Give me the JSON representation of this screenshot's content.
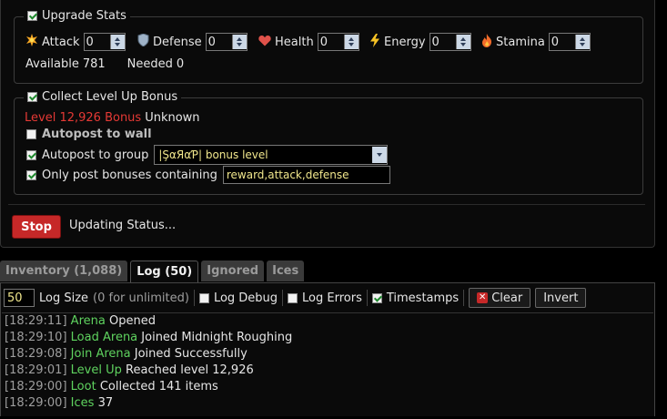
{
  "upgrade": {
    "title": "Upgrade Stats",
    "stats": [
      {
        "label": "Attack",
        "value": "0",
        "icon": "attack-burst-icon"
      },
      {
        "label": "Defense",
        "value": "0",
        "icon": "shield-icon"
      },
      {
        "label": "Health",
        "value": "0",
        "icon": "heart-icon"
      },
      {
        "label": "Energy",
        "value": "0",
        "icon": "lightning-icon"
      },
      {
        "label": "Stamina",
        "value": "0",
        "icon": "flame-icon"
      }
    ],
    "available_label": "Available",
    "available_value": "781",
    "needed_label": "Needed",
    "needed_value": "0"
  },
  "bonus": {
    "title": "Collect Level Up Bonus",
    "level_bonus": "Level 12,926 Bonus",
    "status": "Unknown",
    "autopost_wall": "Autopost to wall",
    "autopost_group": "Autopost to group",
    "group_selected": "|ŞαЯαƤ| bonus level",
    "only_post": "Only post bonuses containing",
    "keywords": "reward,attack,defense"
  },
  "status_bar": {
    "stop_label": "Stop",
    "status_text": "Updating Status..."
  },
  "tabs": [
    {
      "label": "Inventory (1,088)"
    },
    {
      "label": "Log (50)"
    },
    {
      "label": "Ignored"
    },
    {
      "label": "Ices"
    }
  ],
  "log_toolbar": {
    "size_value": "50",
    "size_label": "Log Size",
    "size_hint": "(0 for unlimited)",
    "debug_label": "Log Debug",
    "errors_label": "Log Errors",
    "timestamps_label": "Timestamps",
    "clear_label": "Clear",
    "invert_label": "Invert"
  },
  "log": [
    {
      "time": "[18:29:11]",
      "category": "Arena",
      "message": "Opened"
    },
    {
      "time": "[18:29:10]",
      "category": "Load Arena",
      "message": "Joined Midnight Roughing"
    },
    {
      "time": "[18:29:08]",
      "category": "Join Arena",
      "message": "Joined Successfully"
    },
    {
      "time": "[18:29:01]",
      "category": "Level Up",
      "message": "Reached level 12,926"
    },
    {
      "time": "[18:29:00]",
      "category": "Loot",
      "message": "Collected 141 items"
    },
    {
      "time": "[18:29:00]",
      "category": "Ices",
      "message": "37"
    }
  ],
  "colors": {
    "accent_red": "#c62828",
    "log_category": "#5fd35f",
    "input_text": "#f0e68c"
  }
}
